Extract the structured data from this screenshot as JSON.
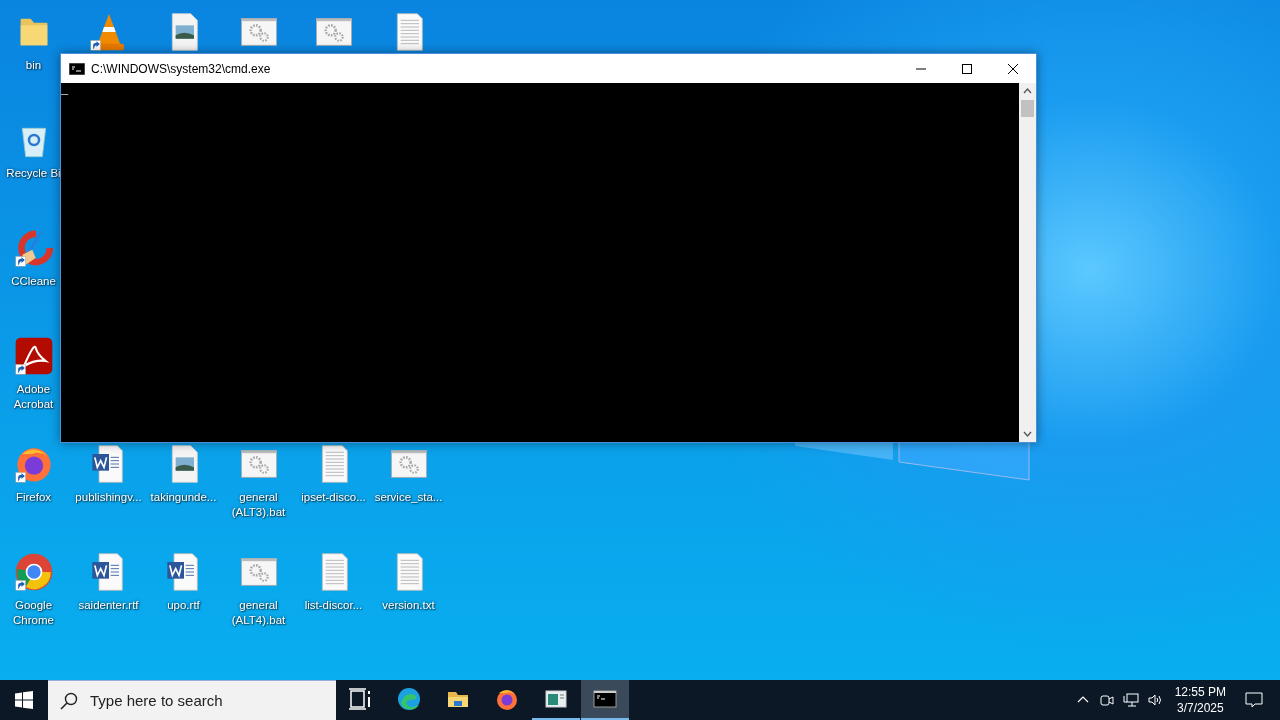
{
  "desktop": {
    "left_column": [
      {
        "kind": "folder",
        "label": "bin",
        "shortcut": false
      },
      {
        "kind": "recycle",
        "label": "Recycle Bi",
        "shortcut": false
      },
      {
        "kind": "ccleaner",
        "label": "CCleane",
        "shortcut": true
      },
      {
        "kind": "acrobat",
        "label": "Adobe Acrobat",
        "shortcut": true
      },
      {
        "kind": "firefox",
        "label": "Firefox",
        "shortcut": true
      },
      {
        "kind": "chrome",
        "label": "Google Chrome",
        "shortcut": true
      }
    ],
    "top_row": [
      {
        "kind": "vlc",
        "shortcut": true
      },
      {
        "kind": "image",
        "shortcut": false
      },
      {
        "kind": "bat",
        "shortcut": false
      },
      {
        "kind": "bat",
        "shortcut": false
      },
      {
        "kind": "text",
        "shortcut": false
      }
    ],
    "lower_rows": [
      [
        {
          "kind": "word",
          "label": "publishingv...",
          "shortcut": false
        },
        {
          "kind": "image",
          "label": "takingunde...",
          "shortcut": false
        },
        {
          "kind": "bat",
          "label": "general (ALT3).bat",
          "shortcut": false
        },
        {
          "kind": "text",
          "label": "ipset-disco...",
          "shortcut": false
        },
        {
          "kind": "bat",
          "label": "service_sta...",
          "shortcut": false
        }
      ],
      [
        {
          "kind": "word",
          "label": "saidenter.rtf",
          "shortcut": false
        },
        {
          "kind": "word",
          "label": "upo.rtf",
          "shortcut": false
        },
        {
          "kind": "bat",
          "label": "general (ALT4).bat",
          "shortcut": false
        },
        {
          "kind": "text",
          "label": "list-discor...",
          "shortcut": false
        },
        {
          "kind": "text",
          "label": "version.txt",
          "shortcut": false
        }
      ]
    ]
  },
  "window": {
    "title": "C:\\WINDOWS\\system32\\cmd.exe",
    "cursor": "_"
  },
  "taskbar": {
    "search": {
      "placeholder": "Type here to search"
    },
    "apps": [
      {
        "kind": "taskview",
        "running": false,
        "selected": false
      },
      {
        "kind": "edge",
        "running": false,
        "selected": false
      },
      {
        "kind": "explorer",
        "running": false,
        "selected": false
      },
      {
        "kind": "firefox",
        "running": false,
        "selected": false
      },
      {
        "kind": "app",
        "running": true,
        "selected": false
      },
      {
        "kind": "cmd",
        "running": true,
        "selected": true
      }
    ],
    "tray": {
      "time": "12:55 PM",
      "date": "3/7/2025"
    }
  }
}
